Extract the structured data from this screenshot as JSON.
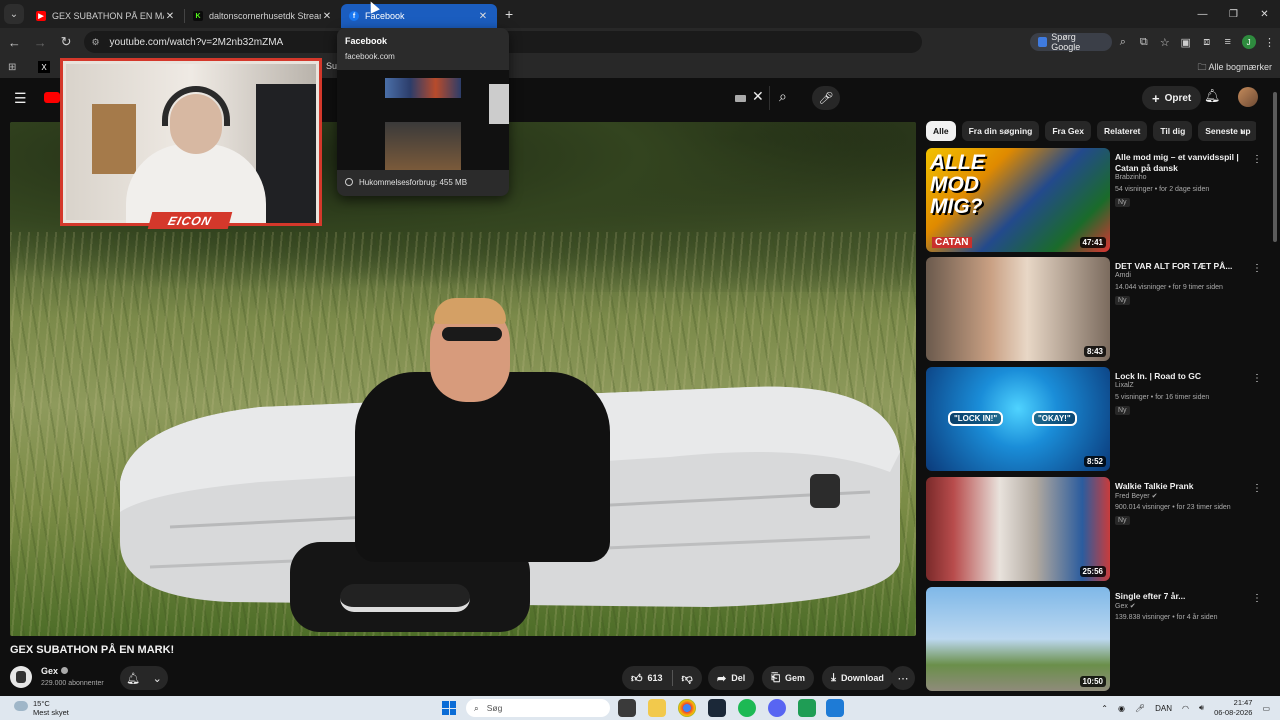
{
  "browser": {
    "tabs": [
      {
        "title": "GEX SUBATHON PÅ EN MARK!",
        "favicon_color": "#ff0000",
        "active": false
      },
      {
        "title": "daltonscornerhusetdk Stream",
        "favicon_color": "#53fc18",
        "active": false
      },
      {
        "title": "Facebook",
        "favicon_color": "#1877f2",
        "active": true
      }
    ],
    "url": "youtube.com/watch?v=2M2nb32mZMA",
    "google_button": "Spørg Google",
    "profile_initial": "J",
    "bookmarks": {
      "apps_icon": "apps-grid-icon",
      "x_label": "X",
      "truncated": "Su",
      "all_bookmarks": "Alle bogmærker"
    },
    "hover_card": {
      "title": "Facebook",
      "domain": "facebook.com",
      "memory": "Hukommelsesforbrug: 455 MB"
    }
  },
  "youtube": {
    "create_label": "Opret",
    "video_title": "GEX SUBATHON PÅ EN MARK!",
    "channel_name": "Gex",
    "subscribers": "229.000 abonnenter",
    "likes": "613",
    "share_label": "Del",
    "save_label": "Gem",
    "download_label": "Download",
    "webcam_brand": "EICON",
    "chips": [
      "Alle",
      "Fra din søgning",
      "Fra Gex",
      "Relateret",
      "Til dig",
      "Seneste up"
    ],
    "recommendations": [
      {
        "title": "Alle mod mig – et vanvidsspil | Catan på dansk",
        "channel": "Brabzinho",
        "views": "54 visninger • for 2 dage siden",
        "badge": "Ny",
        "duration": "47:41",
        "thumb_text": "ALLE MOD MIG?",
        "thumb_sub": "CATAN"
      },
      {
        "title": "DET VAR ALT FOR TÆT PÅ...",
        "channel": "Amdi",
        "views": "14.044 visninger • for 9 timer siden",
        "badge": "Ny",
        "duration": "8:43"
      },
      {
        "title": "Lock In. | Road to GC",
        "channel": "LixalZ",
        "views": "5 visninger • for 16 timer siden",
        "badge": "Ny",
        "duration": "8:52",
        "thumb_left": "\"LOCK IN!\"",
        "thumb_right": "\"OKAY!\""
      },
      {
        "title": "Walkie Talkie Prank",
        "channel": "Fred Beyer",
        "views": "900.014 visninger • for 23 timer siden",
        "badge": "Ny",
        "duration": "25:56"
      },
      {
        "title": "Single efter 7 år...",
        "channel": "Gex",
        "views": "139.838 visninger • for 4 år siden",
        "badge": "",
        "duration": "10:50"
      }
    ]
  },
  "taskbar": {
    "temperature": "15°C",
    "weather": "Mest skyet",
    "search_placeholder": "Søg",
    "language": "DAN",
    "time": "21:47",
    "date": "06-08-2026"
  }
}
